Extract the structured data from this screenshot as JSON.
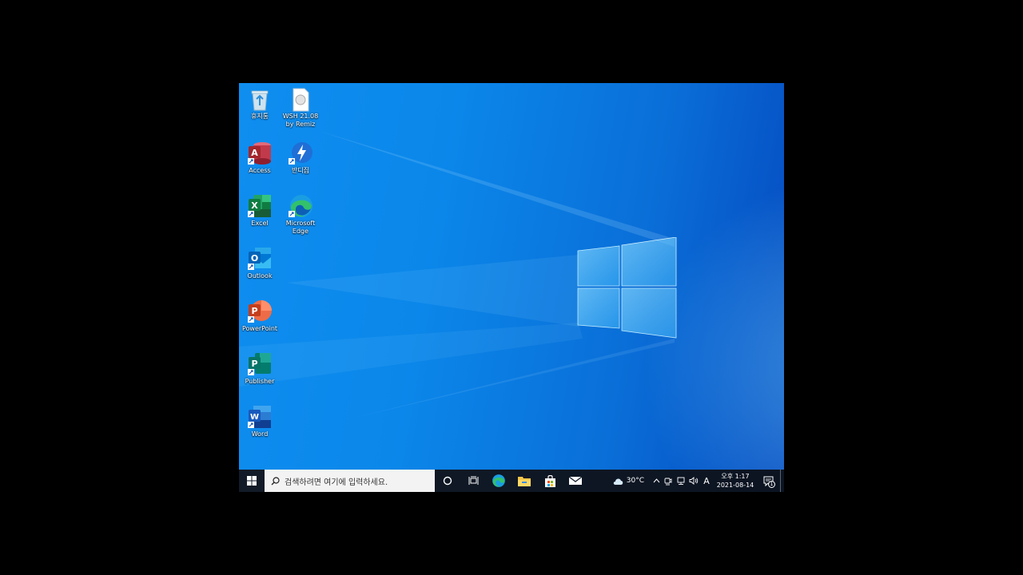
{
  "desktop": {
    "icons": [
      {
        "label": "휴지통"
      },
      {
        "label": "WSH 21.08 by Remiz"
      },
      {
        "label": "Access"
      },
      {
        "label": "반디집"
      },
      {
        "label": "Excel"
      },
      {
        "label": "Microsoft Edge"
      },
      {
        "label": "Outlook"
      },
      {
        "label": "PowerPoint"
      },
      {
        "label": "Publisher"
      },
      {
        "label": "Word"
      }
    ]
  },
  "taskbar": {
    "search_placeholder": "검색하려면 여기에 입력하세요.",
    "pinned": [
      "cortana-icon",
      "task-view-icon",
      "edge-icon",
      "file-explorer-icon",
      "store-icon",
      "mail-icon"
    ],
    "weather": "30°C",
    "ime": "A",
    "clock_time": "오후 1:17",
    "clock_date": "2021-08-14",
    "notification_count": "1"
  },
  "colors": {
    "wallpaper_light": "#1aa3f5",
    "wallpaper_dark": "#0548bf",
    "taskbar": "#121b27",
    "search_bg": "#f3f3f3"
  }
}
